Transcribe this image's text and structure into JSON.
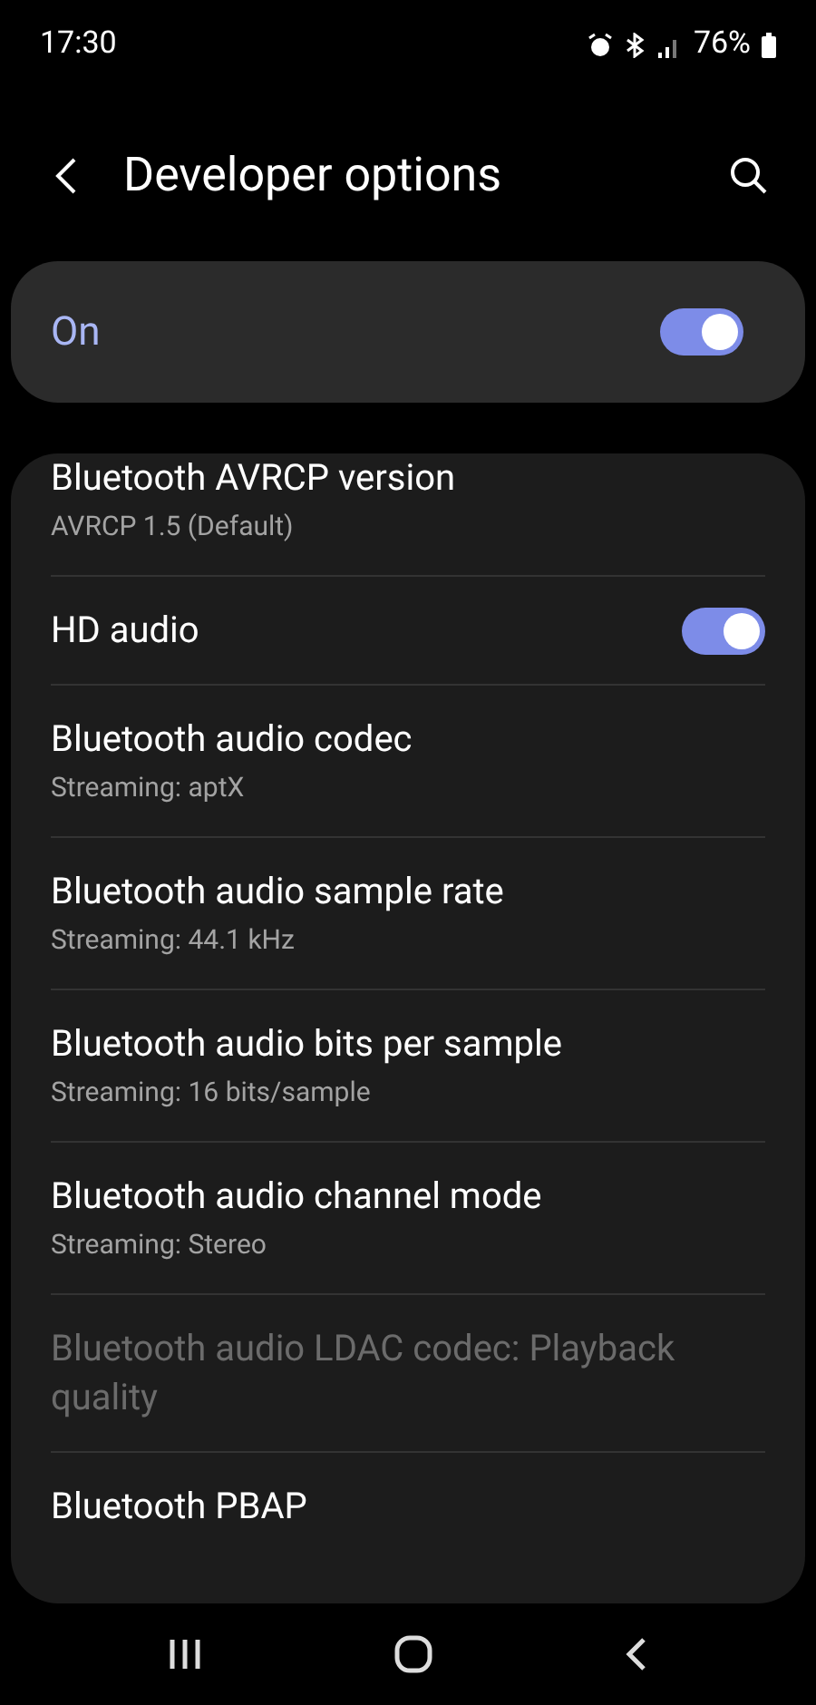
{
  "status_bar": {
    "time": "17:30",
    "battery": "76%"
  },
  "header": {
    "title": "Developer options"
  },
  "master_switch": {
    "label": "On",
    "on": true
  },
  "settings": [
    {
      "title": "Bluetooth AVRCP version",
      "subtitle": "AVRCP 1.5 (Default)",
      "disabled": false
    },
    {
      "title": "HD audio",
      "toggle": {
        "on": true
      },
      "disabled": false
    },
    {
      "title": "Bluetooth audio codec",
      "subtitle": "Streaming: aptX",
      "disabled": false
    },
    {
      "title": "Bluetooth audio sample rate",
      "subtitle": "Streaming: 44.1 kHz",
      "disabled": false
    },
    {
      "title": "Bluetooth audio bits per sample",
      "subtitle": "Streaming: 16 bits/sample",
      "disabled": false
    },
    {
      "title": "Bluetooth audio channel mode",
      "subtitle": "Streaming: Stereo",
      "disabled": false
    },
    {
      "title": "Bluetooth audio LDAC codec: Playback quality",
      "disabled": true
    },
    {
      "title": "Bluetooth PBAP",
      "disabled": false
    }
  ]
}
